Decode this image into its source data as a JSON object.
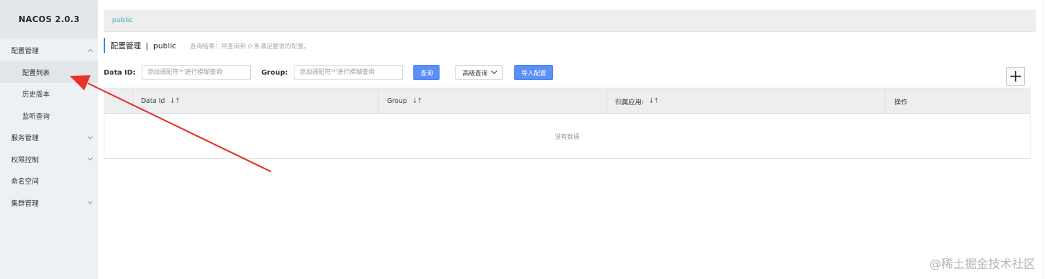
{
  "brand": {
    "title": "NACOS 2.0.3"
  },
  "sidebar": {
    "groups": [
      {
        "label": "配置管理",
        "expanded": true,
        "items": [
          {
            "label": "配置列表",
            "active": true
          },
          {
            "label": "历史版本"
          },
          {
            "label": "监听查询"
          }
        ]
      },
      {
        "label": "服务管理",
        "expanded": false
      },
      {
        "label": "权限控制",
        "expanded": false
      },
      {
        "label": "命名空间"
      },
      {
        "label": "集群管理",
        "expanded": false
      }
    ]
  },
  "namespace_bar": {
    "label": "public"
  },
  "page": {
    "title": "配置管理",
    "separator": "|",
    "namespace": "public",
    "result_text": "查询结果：共查询到 0 条满足要求的配置。"
  },
  "search": {
    "data_id_label": "Data ID:",
    "data_id_placeholder": "添加通配符'*'进行模糊查询",
    "group_label": "Group:",
    "group_placeholder": "添加通配符'*'进行模糊查询",
    "query_button": "查询",
    "advanced_button": "高级查询",
    "import_button": "导入配置"
  },
  "table": {
    "columns": [
      {
        "label": "Data Id",
        "sortable": true
      },
      {
        "label": "Group",
        "sortable": true
      },
      {
        "label": "归属应用:",
        "sortable": true
      },
      {
        "label": "操作",
        "sortable": false
      }
    ],
    "sort_icon": "↓↑",
    "empty_text": "没有数据"
  },
  "icons": {
    "add": "plus-icon",
    "annotation": "red-arrow"
  },
  "colors": {
    "primary_button": "#5b8ff9",
    "link": "#2aa3c7",
    "title_accent": "#2c8fc5",
    "arrow": "#e8332a",
    "sidebar_bg": "#eef1f4"
  },
  "watermark": "@稀土掘金技术社区"
}
